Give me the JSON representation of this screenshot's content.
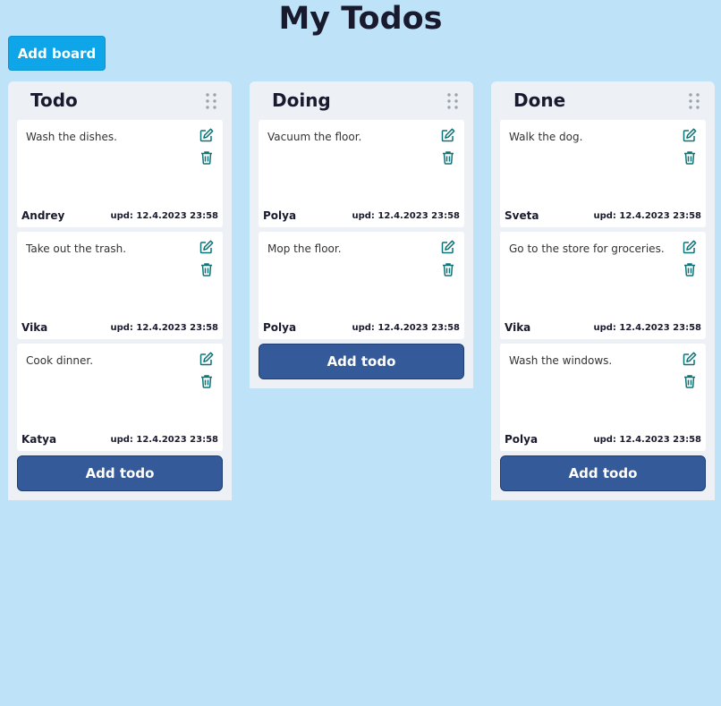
{
  "title": "My Todos",
  "add_board_label": "Add board",
  "colors": {
    "background": "#bee3f8",
    "board_bg": "#edf1f5",
    "add_board_button": "#0ea5e9",
    "add_todo_button": "#355a99",
    "icon_color": "#0d7377"
  },
  "icons": {
    "drag": "drag-handle-icon",
    "edit": "pencil-square-icon",
    "delete": "trash-icon"
  },
  "boards": [
    {
      "title": "Todo",
      "add_todo_label": "Add todo",
      "cards": [
        {
          "text": "Wash the dishes.",
          "author": "Andrey",
          "updated": "upd: 12.4.2023 23:58"
        },
        {
          "text": "Take out the trash.",
          "author": "Vika",
          "updated": "upd: 12.4.2023 23:58"
        },
        {
          "text": "Cook dinner.",
          "author": "Katya",
          "updated": "upd: 12.4.2023 23:58"
        }
      ]
    },
    {
      "title": "Doing",
      "add_todo_label": "Add todo",
      "cards": [
        {
          "text": "Vacuum the floor.",
          "author": "Polya",
          "updated": "upd: 12.4.2023 23:58"
        },
        {
          "text": "Mop the floor.",
          "author": "Polya",
          "updated": "upd: 12.4.2023 23:58"
        }
      ]
    },
    {
      "title": "Done",
      "add_todo_label": "Add todo",
      "cards": [
        {
          "text": "Walk the dog.",
          "author": "Sveta",
          "updated": "upd: 12.4.2023 23:58"
        },
        {
          "text": "Go to the store for groceries.",
          "author": "Vika",
          "updated": "upd: 12.4.2023 23:58"
        },
        {
          "text": "Wash the windows.",
          "author": "Polya",
          "updated": "upd: 12.4.2023 23:58"
        }
      ]
    }
  ]
}
